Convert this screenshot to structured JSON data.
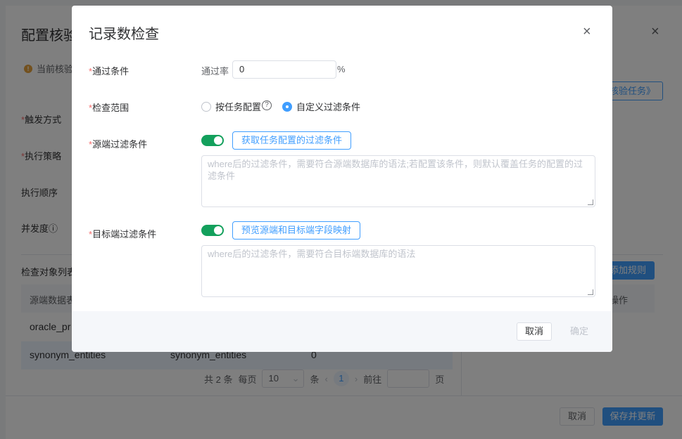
{
  "background": {
    "title": "配置核验",
    "warning": "当前核验规",
    "labels": {
      "trigger": "触发方式",
      "strategy": "执行策略",
      "order": "执行顺序",
      "concurrency": "并发度"
    },
    "check_list_title": "检查对象列表",
    "table_header_source": "源端数据表",
    "rows": [
      {
        "source": "oracle_pr",
        "target": "",
        "count": ""
      },
      {
        "source": "synonym_entities",
        "target": "synonym_entities",
        "count": "0"
      }
    ],
    "right_button_top": "核验任务》",
    "right_button_add": "添加规则",
    "right_header_ops": "操作",
    "pager": {
      "total": "共 2 条",
      "per_page_label": "每页",
      "per_page_value": "10",
      "per_page_unit": "条",
      "current_page": "1",
      "goto_label": "前往",
      "page_unit": "页",
      "prev": "‹",
      "next": "›"
    },
    "footer": {
      "cancel": "取消",
      "save": "保存并更新"
    }
  },
  "dialog": {
    "title": "记录数检查",
    "close": "×",
    "pass_condition": {
      "label": "通过条件",
      "rate_label": "通过率",
      "rate_value": "0",
      "unit": "%"
    },
    "check_scope": {
      "label": "检查范围",
      "options": [
        "按任务配置",
        "自定义过滤条件"
      ],
      "selected": "自定义过滤条件",
      "help": "?"
    },
    "source_filter": {
      "label": "源端过滤条件",
      "enabled": true,
      "button": "获取任务配置的过滤条件",
      "placeholder": "where后的过滤条件，需要符合源端数据库的语法;若配置该条件，则默认覆盖任务的配置的过滤条件"
    },
    "target_filter": {
      "label": "目标端过滤条件",
      "enabled": true,
      "button": "预览源端和目标端字段映射",
      "placeholder": "where后的过滤条件，需要符合目标端数据库的语法"
    },
    "footer": {
      "cancel": "取消",
      "confirm": "确定"
    }
  },
  "colors": {
    "primary": "#409eff",
    "switch_on": "#13a05c",
    "required": "#f56c6c",
    "warning": "#e6a23c"
  }
}
